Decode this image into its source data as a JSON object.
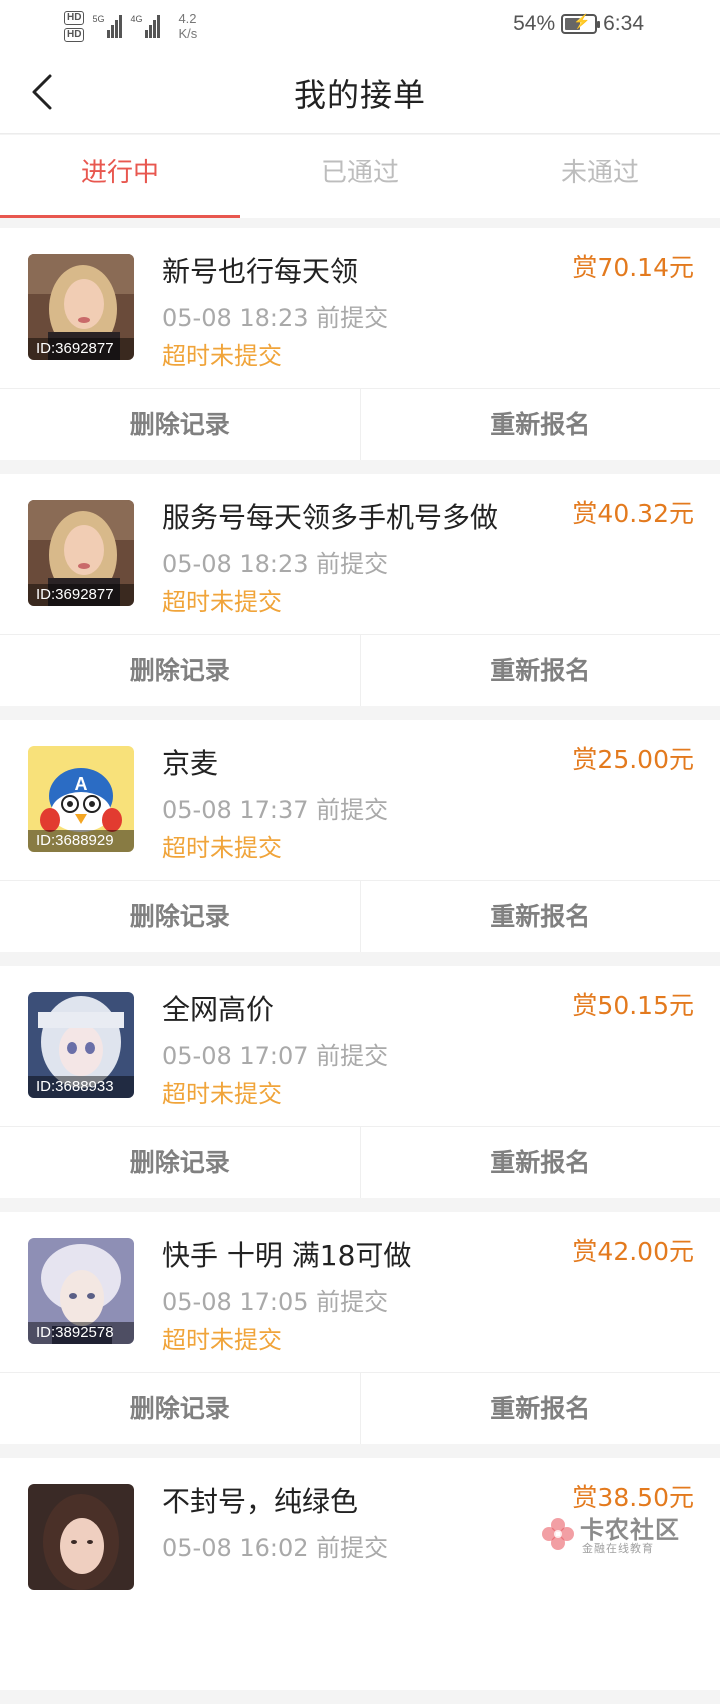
{
  "status_bar": {
    "hd_top": "HD",
    "hd_bottom": "HD",
    "net1": "5G",
    "net2": "4G",
    "speed_value": "4.2",
    "speed_unit": "K/s",
    "battery_pct": "54%",
    "battery_level": 0.54,
    "time": "6:34"
  },
  "nav": {
    "back_icon": "chevron-left-icon",
    "title": "我的接单"
  },
  "tabs": [
    {
      "label": "进行中",
      "active": true
    },
    {
      "label": "已通过",
      "active": false
    },
    {
      "label": "未通过",
      "active": false
    }
  ],
  "colors": {
    "accent": "#e8574f",
    "reward": "#e37a1e",
    "status": "#f0a43a"
  },
  "orders": [
    {
      "avatar_id": "ID:3692877",
      "title": "新号也行每天领",
      "time": "05-08 18:23 前提交",
      "status": "超时未提交",
      "reward": "赏70.14元",
      "delete_label": "删除记录",
      "reapply_label": "重新报名"
    },
    {
      "avatar_id": "ID:3692877",
      "title": "服务号每天领多手机号多做",
      "time": "05-08 18:23 前提交",
      "status": "超时未提交",
      "reward": "赏40.32元",
      "delete_label": "删除记录",
      "reapply_label": "重新报名"
    },
    {
      "avatar_id": "ID:3688929",
      "title": "京麦",
      "time": "05-08 17:37 前提交",
      "status": "超时未提交",
      "reward": "赏25.00元",
      "delete_label": "删除记录",
      "reapply_label": "重新报名"
    },
    {
      "avatar_id": "ID:3688933",
      "title": "全网高价",
      "time": "05-08 17:07 前提交",
      "status": "超时未提交",
      "reward": "赏50.15元",
      "delete_label": "删除记录",
      "reapply_label": "重新报名"
    },
    {
      "avatar_id": "ID:3892578",
      "title": "快手 十明 满18可做",
      "time": "05-08 17:05 前提交",
      "status": "超时未提交",
      "reward": "赏42.00元",
      "delete_label": "删除记录",
      "reapply_label": "重新报名"
    },
    {
      "avatar_id": "",
      "title": "不封号，纯绿色",
      "time": "05-08 16:02 前提交",
      "status": "",
      "reward": "赏38.50元",
      "delete_label": "",
      "reapply_label": ""
    }
  ],
  "watermark": {
    "text": "卡农社区",
    "sub": "金融在线教育"
  }
}
